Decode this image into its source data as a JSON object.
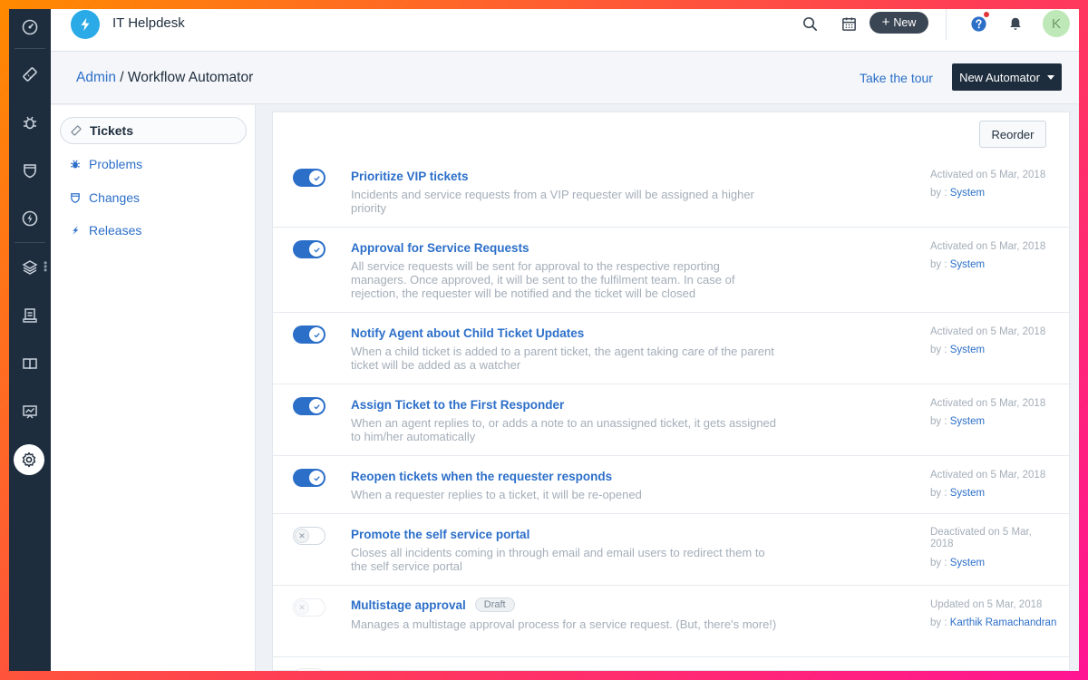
{
  "header": {
    "app_title": "IT Helpdesk",
    "new_label": "New",
    "avatar_initial": "K"
  },
  "breadcrumb": {
    "parent": "Admin",
    "separator": " / ",
    "current": "Workflow Automator"
  },
  "actions": {
    "tour_label": "Take the tour",
    "new_automator_label": "New Automator",
    "reorder_label": "Reorder"
  },
  "leftnav": {
    "items": [
      {
        "label": "Tickets",
        "icon": "ticket-icon",
        "active": true
      },
      {
        "label": "Problems",
        "icon": "bug-icon",
        "active": false
      },
      {
        "label": "Changes",
        "icon": "shield-icon",
        "active": false
      },
      {
        "label": "Releases",
        "icon": "lightning-icon",
        "active": false
      }
    ]
  },
  "rail": {
    "icons": [
      "dashboard-icon",
      "ticket-icon",
      "bug-icon",
      "shield-icon",
      "lightning-icon",
      "layers-icon",
      "document-icon",
      "book-icon",
      "chart-icon",
      "gear-icon"
    ]
  },
  "automators": [
    {
      "title": "Prioritize VIP tickets",
      "description": "Incidents and service requests from a VIP requester will be assigned a higher priority",
      "status": "Activated on 5 Mar, 2018",
      "by_label": "by : ",
      "by": "System",
      "enabled": true
    },
    {
      "title": "Approval for Service Requests",
      "description": "All service requests will be sent for approval to the respective reporting managers. Once approved, it will be sent to the fulfilment team. In case of rejection, the requester will be notified and the ticket will be closed",
      "status": "Activated on 5 Mar, 2018",
      "by_label": "by : ",
      "by": "System",
      "enabled": true
    },
    {
      "title": "Notify Agent about Child Ticket Updates",
      "description": "When a child ticket is added to a parent ticket, the agent taking care of the parent ticket will be added as a watcher",
      "status": "Activated on 5 Mar, 2018",
      "by_label": "by : ",
      "by": "System",
      "enabled": true
    },
    {
      "title": "Assign Ticket to the First Responder",
      "description": "When an agent replies to, or adds a note to an unassigned ticket, it gets assigned to him/her automatically",
      "status": "Activated on 5 Mar, 2018",
      "by_label": "by : ",
      "by": "System",
      "enabled": true
    },
    {
      "title": "Reopen tickets when the requester responds",
      "description": "When a requester replies to a ticket, it will be re-opened",
      "status": "Activated on 5 Mar, 2018",
      "by_label": "by : ",
      "by": "System",
      "enabled": true
    },
    {
      "title": "Promote the self service portal",
      "description": "Closes all incidents coming in through email and email users to redirect them to the self service portal",
      "status": "Deactivated on 5 Mar, 2018",
      "by_label": "by : ",
      "by": "System",
      "enabled": false
    },
    {
      "title": "Multistage approval",
      "badge": "Draft",
      "description": "Manages a multistage approval process for a service request. (But, there's more!)",
      "status": "Updated on 5 Mar, 2018",
      "by_label": "by : ",
      "by": "Karthik Ramachandran",
      "enabled": false,
      "draft": true
    }
  ],
  "colors": {
    "primary": "#2c6fc9",
    "rail": "#1e2d3d",
    "muted": "#a4aeb9"
  }
}
